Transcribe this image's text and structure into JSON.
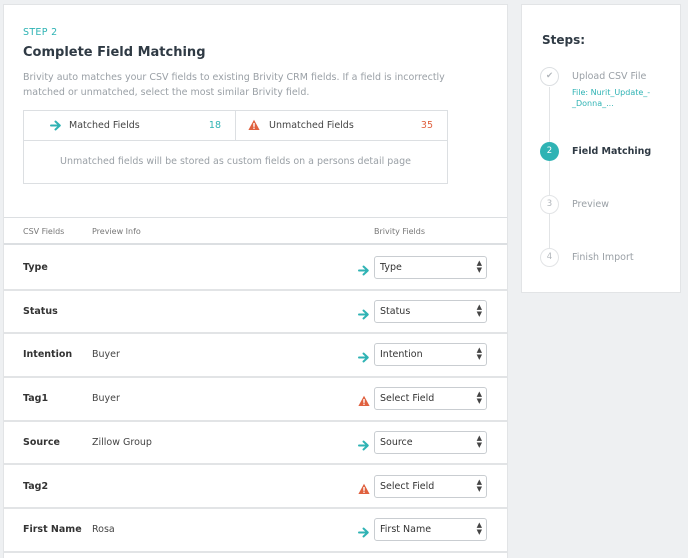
{
  "main": {
    "step_label": "STEP 2",
    "title": "Complete Field Matching",
    "description": "Brivity auto matches your CSV fields to existing Brivity CRM fields. If a field is incorrectly matched or unmatched, select the most similar Brivity field.",
    "summary": {
      "matched_label": "Matched Fields",
      "matched_count": "18",
      "unmatched_label": "Unmatched Fields",
      "unmatched_count": "35",
      "note": "Unmatched fields will be stored as custom fields on a persons detail page"
    },
    "table": {
      "headers": {
        "csv": "CSV Fields",
        "preview": "Preview Info",
        "brivity": "Brivity Fields"
      },
      "rows": [
        {
          "csv": "Type",
          "preview": "",
          "status": "matched",
          "selected": "Type"
        },
        {
          "csv": "Status",
          "preview": "",
          "status": "matched",
          "selected": "Status"
        },
        {
          "csv": "Intention",
          "preview": "Buyer",
          "status": "matched",
          "selected": "Intention"
        },
        {
          "csv": "Tag1",
          "preview": "Buyer",
          "status": "unmatched",
          "selected": "Select Field"
        },
        {
          "csv": "Source",
          "preview": "Zillow Group",
          "status": "matched",
          "selected": "Source"
        },
        {
          "csv": "Tag2",
          "preview": "",
          "status": "unmatched",
          "selected": "Select Field"
        },
        {
          "csv": "First Name",
          "preview": "Rosa",
          "status": "matched",
          "selected": "First Name"
        }
      ]
    }
  },
  "sidebar": {
    "title": "Steps:",
    "steps": [
      {
        "number": "✔",
        "name": "Upload CSV File",
        "file": "File: Nurit_Update_-_Donna_...",
        "state": "done"
      },
      {
        "number": "2",
        "name": "Field Matching",
        "state": "active"
      },
      {
        "number": "3",
        "name": "Preview",
        "state": "pending"
      },
      {
        "number": "4",
        "name": "Finish Import",
        "state": "pending"
      }
    ]
  },
  "colors": {
    "accent": "#2fb3b4",
    "warning": "#e0613f"
  },
  "icons": {
    "matched": "arrow-right-icon",
    "unmatched": "warning-icon",
    "select": "chevron-updown-icon",
    "done": "check-icon"
  }
}
